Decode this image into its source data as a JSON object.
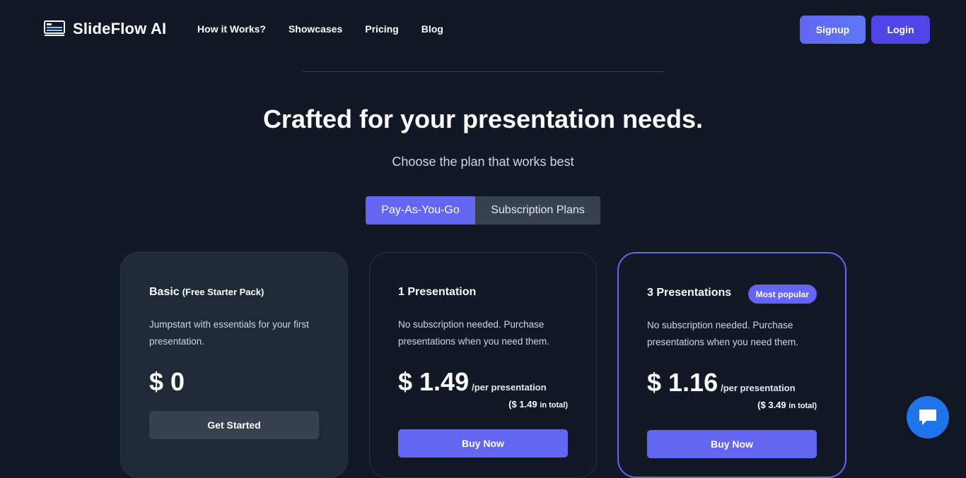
{
  "header": {
    "brand": "SlideFlow AI",
    "nav": [
      {
        "label": "How it Works?"
      },
      {
        "label": "Showcases"
      },
      {
        "label": "Pricing"
      },
      {
        "label": "Blog"
      }
    ],
    "signup_label": "Signup",
    "login_label": "Login"
  },
  "hero": {
    "title": "Crafted for your presentation needs.",
    "subtitle": "Choose the plan that works best"
  },
  "toggle": {
    "options": [
      "Pay-As-You-Go",
      "Subscription Plans"
    ],
    "selected": "Pay-As-You-Go"
  },
  "plans": [
    {
      "title": "Basic",
      "title_suffix": "(Free Starter Pack)",
      "description": "Jumpstart with essentials for your first presentation.",
      "price": "$ 0",
      "button": "Get Started"
    },
    {
      "title": "1 Presentation",
      "description": "No subscription needed. Purchase presentations when you need them.",
      "price": "$ 1.49",
      "per": "/per presentation",
      "total_amount": "($ 1.49",
      "total_suffix": "in total)",
      "button": "Buy Now"
    },
    {
      "title": "3 Presentations",
      "badge": "Most popular",
      "description": "No subscription needed. Purchase presentations when you need them.",
      "price": "$ 1.16",
      "per": "/per presentation",
      "total_amount": "($ 3.49",
      "total_suffix": "in total)",
      "button": "Buy Now"
    }
  ],
  "colors": {
    "background": "#121826",
    "accent": "#6366f1",
    "card": "#1f2937",
    "chat": "#1e74e8"
  },
  "icons": {
    "logo": "slides-logo-icon",
    "chat": "chat-icon"
  }
}
